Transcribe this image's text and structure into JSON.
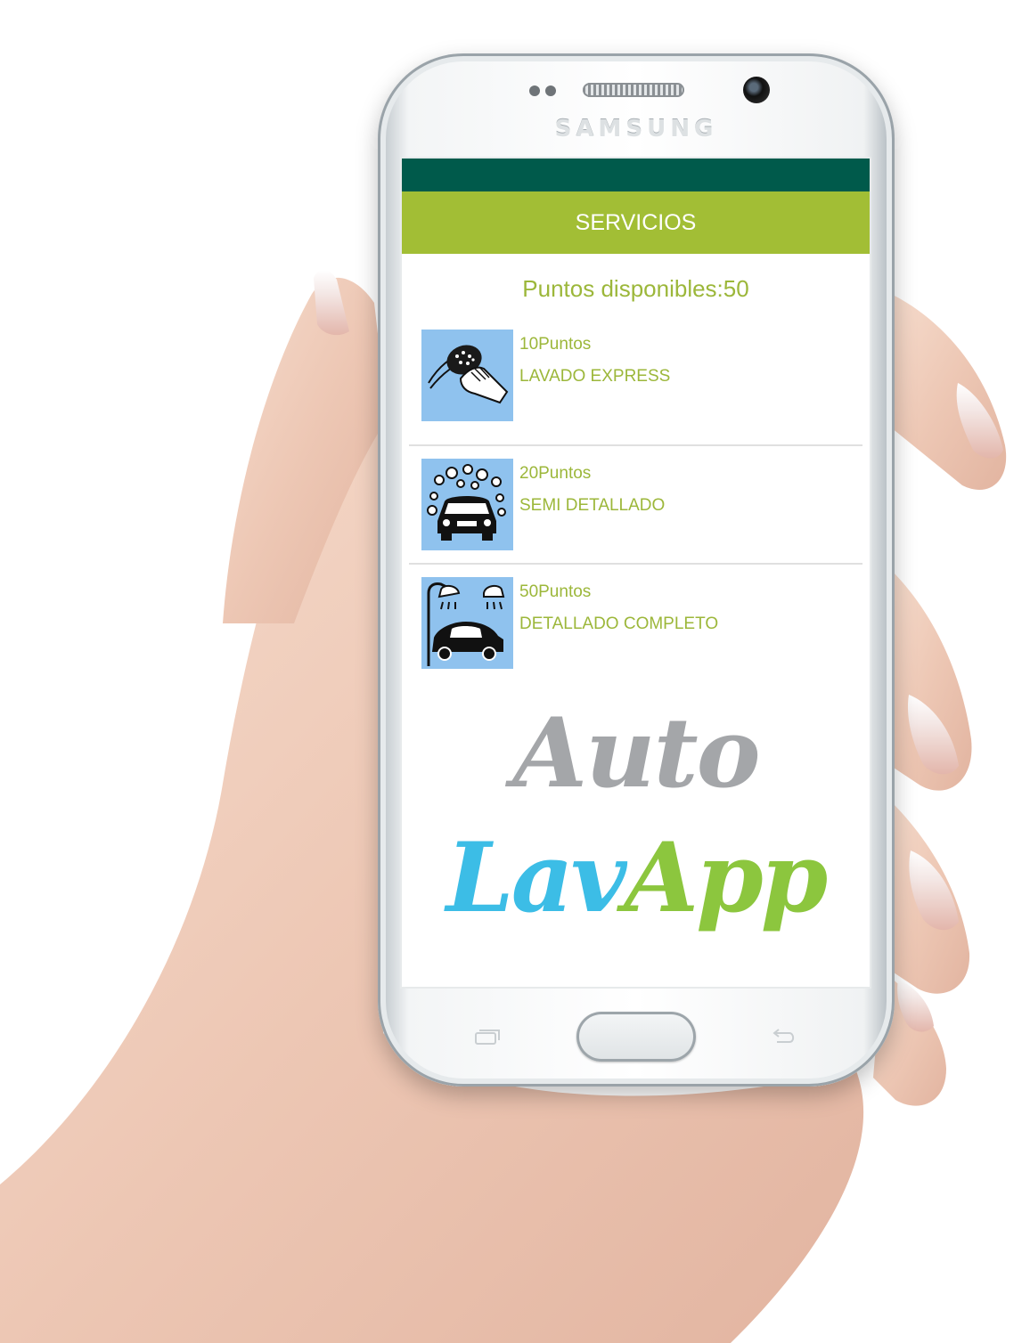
{
  "device": {
    "brand": "SAMSUNG"
  },
  "app_bar": {
    "title": "SERVICIOS"
  },
  "points_summary": "Puntos disponibles:50",
  "services": [
    {
      "points": "10Puntos",
      "name": "LAVADO EXPRESS",
      "icon": "hand-sponge-wash-icon"
    },
    {
      "points": "20Puntos",
      "name": "SEMI DETALLADO",
      "icon": "car-foam-wash-icon"
    },
    {
      "points": "50Puntos",
      "name": "DETALLADO COMPLETO",
      "icon": "car-shower-wash-icon"
    }
  ],
  "logo": {
    "line1": "Auto",
    "line2_part1": "Lav",
    "line2_part2": "App"
  },
  "colors": {
    "status_bar": "#005a4b",
    "app_bar": "#a2be35",
    "accent_text": "#9cb73a",
    "thumb_bg": "#8fc2ee",
    "logo_gray": "#a4a6a9",
    "logo_blue": "#3cbde6",
    "logo_green": "#8cc63e"
  }
}
